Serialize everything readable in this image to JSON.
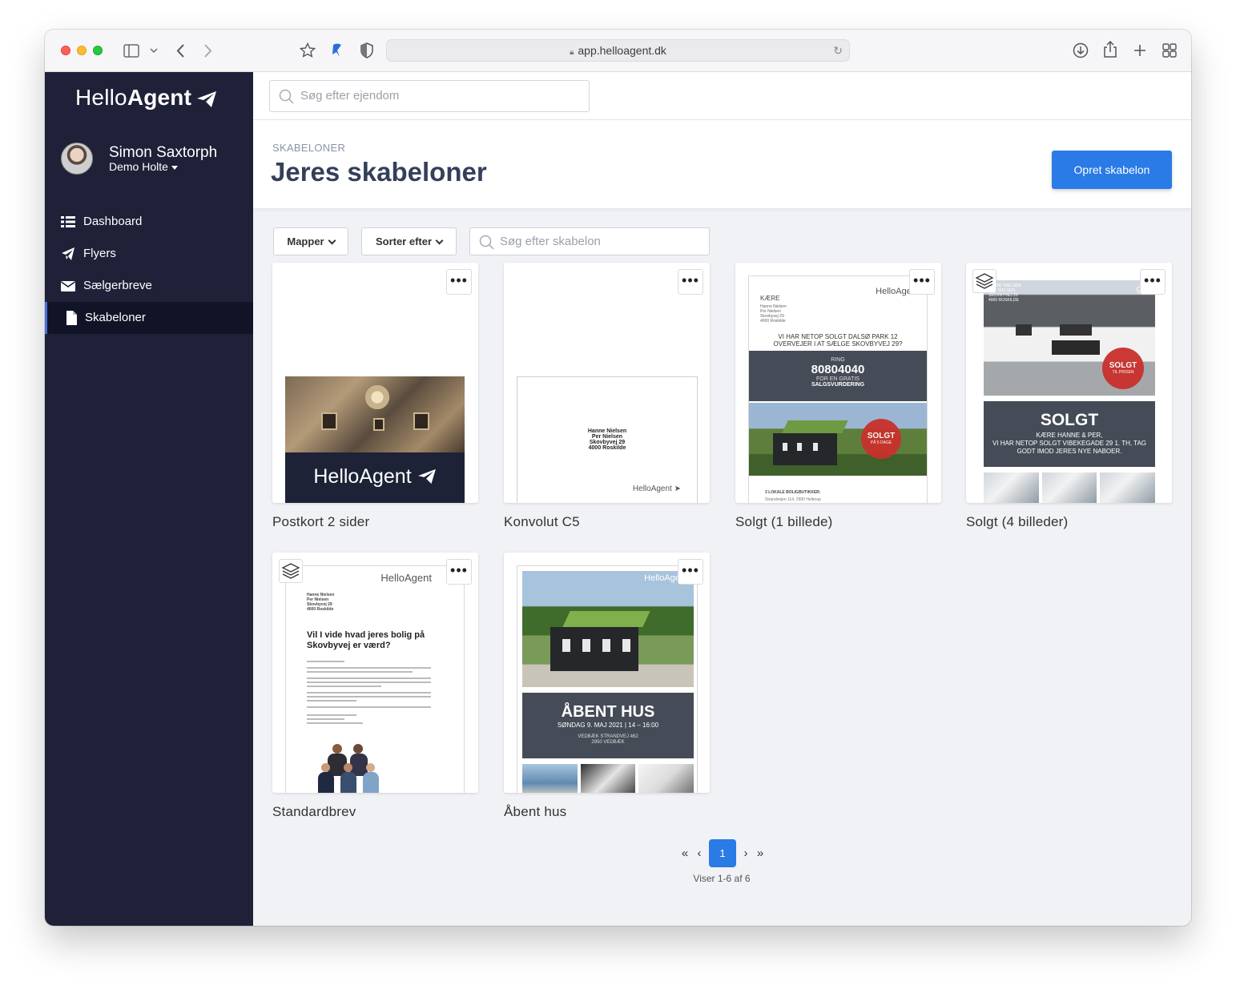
{
  "browser": {
    "url": "app.helloagent.dk"
  },
  "sidebar": {
    "logo_light": "Hello",
    "logo_bold": "Agent",
    "user_name": "Simon Saxtorph",
    "user_org": "Demo Holte",
    "items": [
      {
        "label": "Dashboard",
        "icon": "list-icon"
      },
      {
        "label": "Flyers",
        "icon": "paper-plane-icon"
      },
      {
        "label": "Sælgerbreve",
        "icon": "envelope-icon"
      },
      {
        "label": "Skabeloner",
        "icon": "file-icon",
        "active": true
      }
    ]
  },
  "topbar": {
    "search_placeholder": "Søg efter ejendom"
  },
  "header": {
    "breadcrumb": "SKABELONER",
    "title": "Jeres skabeloner",
    "create_button": "Opret skabelon"
  },
  "filters": {
    "folders_label": "Mapper",
    "sort_label": "Sorter efter",
    "search_placeholder": "Søg efter skabelon"
  },
  "templates": [
    {
      "label": "Postkort 2 sider",
      "logo_text": "HelloAgent"
    },
    {
      "label": "Konvolut C5",
      "address": [
        "Hanne Nielsen",
        "Per Nielsen",
        "Skovbyvej 29",
        "4000 Roskilde"
      ],
      "logo_text": "HelloAgent"
    },
    {
      "label": "Solgt (1 billede)",
      "logo_text": "HelloAgent",
      "greeting": "KÆRE",
      "recipient": [
        "Hanne Nielsen",
        "Per Nielsen",
        "Skovbyvej 29",
        "4000 Roskilde"
      ],
      "headline": [
        "VI HAR NETOP SOLGT DALSØ PARK 12",
        "OVERVEJER I AT SÆLGE SKOVBYVEJ 29?"
      ],
      "ring": "RING",
      "phone": "80804040",
      "cta_small": "FOR EN GRATIS",
      "cta_bold": "SALGSVURDERING",
      "badge_title": "SOLGT",
      "badge_sub": "PÅ 5 DAGE",
      "footer_title": "3 LOKALE BOLIGBUTIKKER:",
      "footer_line": "Strandvejen 114, 2900 Hellerup"
    },
    {
      "label": "Solgt (4 billeder)",
      "logo_text": "gent",
      "recipient": [
        "HANNE NIELSEN",
        "PER NIELSEN",
        "SKOVBYVEJ 29",
        "4000 ROSKILDE"
      ],
      "badge_title": "SOLGT",
      "badge_sub": "TIL PRISEN",
      "headline": "SOLGT",
      "lines": [
        "KÆRE HANNE & PER,",
        "VI HAR NETOP SOLGT VIBEKEGADE 29 1. TH, TAG",
        "GODT IMOD JERES NYE NABOER."
      ]
    },
    {
      "label": "Standardbrev",
      "logo_text": "HelloAgent",
      "recipient": [
        "Hanne Nielsen",
        "Per Nielsen",
        "Skovbyvej 29",
        "4000 Roskilde"
      ],
      "headline": "Vil I vide hvad jeres bolig på Skovbyvej er værd?"
    },
    {
      "label": "Åbent hus",
      "logo_text": "HelloAgent",
      "headline": "ÅBENT HUS",
      "date": "SØNDAG 9. MAJ 2021 | 14 – 16:00",
      "address": [
        "VEDBÆK STRANDVEJ 462",
        "2950 VEDBÆK"
      ]
    }
  ],
  "pagination": {
    "first": "«",
    "prev": "‹",
    "current": "1",
    "next": "›",
    "last": "»",
    "info": "Viser 1-6 af 6"
  }
}
